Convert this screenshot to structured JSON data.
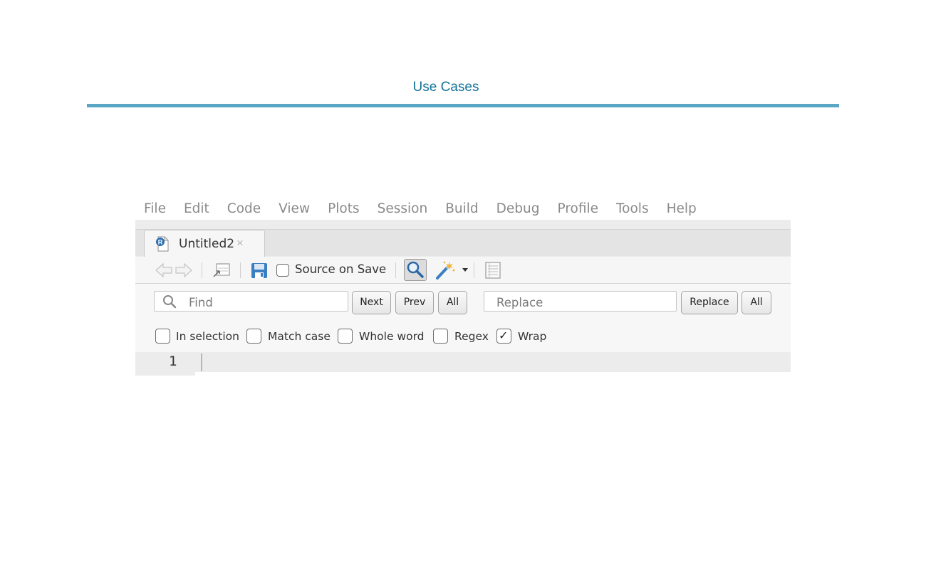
{
  "page": {
    "tab_label": "Use Cases"
  },
  "menu": {
    "items": [
      "File",
      "Edit",
      "Code",
      "View",
      "Plots",
      "Session",
      "Build",
      "Debug",
      "Profile",
      "Tools",
      "Help"
    ]
  },
  "editor_tab": {
    "label": "Untitled2",
    "close": "×",
    "file_icon": "r-file-icon"
  },
  "toolbar": {
    "source_on_save": "Source on Save",
    "source_on_save_checked": false
  },
  "find": {
    "find_placeholder": "Find",
    "next": "Next",
    "prev": "Prev",
    "all_find": "All",
    "replace_placeholder": "Replace",
    "replace_button": "Replace",
    "all_replace": "All"
  },
  "options": {
    "in_selection": {
      "label": "In selection",
      "checked": false
    },
    "match_case": {
      "label": "Match case",
      "checked": false
    },
    "whole_word": {
      "label": "Whole word",
      "checked": false
    },
    "regex": {
      "label": "Regex",
      "checked": false
    },
    "wrap": {
      "label": "Wrap",
      "checked": true,
      "mark": "✓"
    }
  },
  "editor": {
    "line_number": "1"
  },
  "colors": {
    "accent": "#147399",
    "rule": "#5aa6c5"
  }
}
